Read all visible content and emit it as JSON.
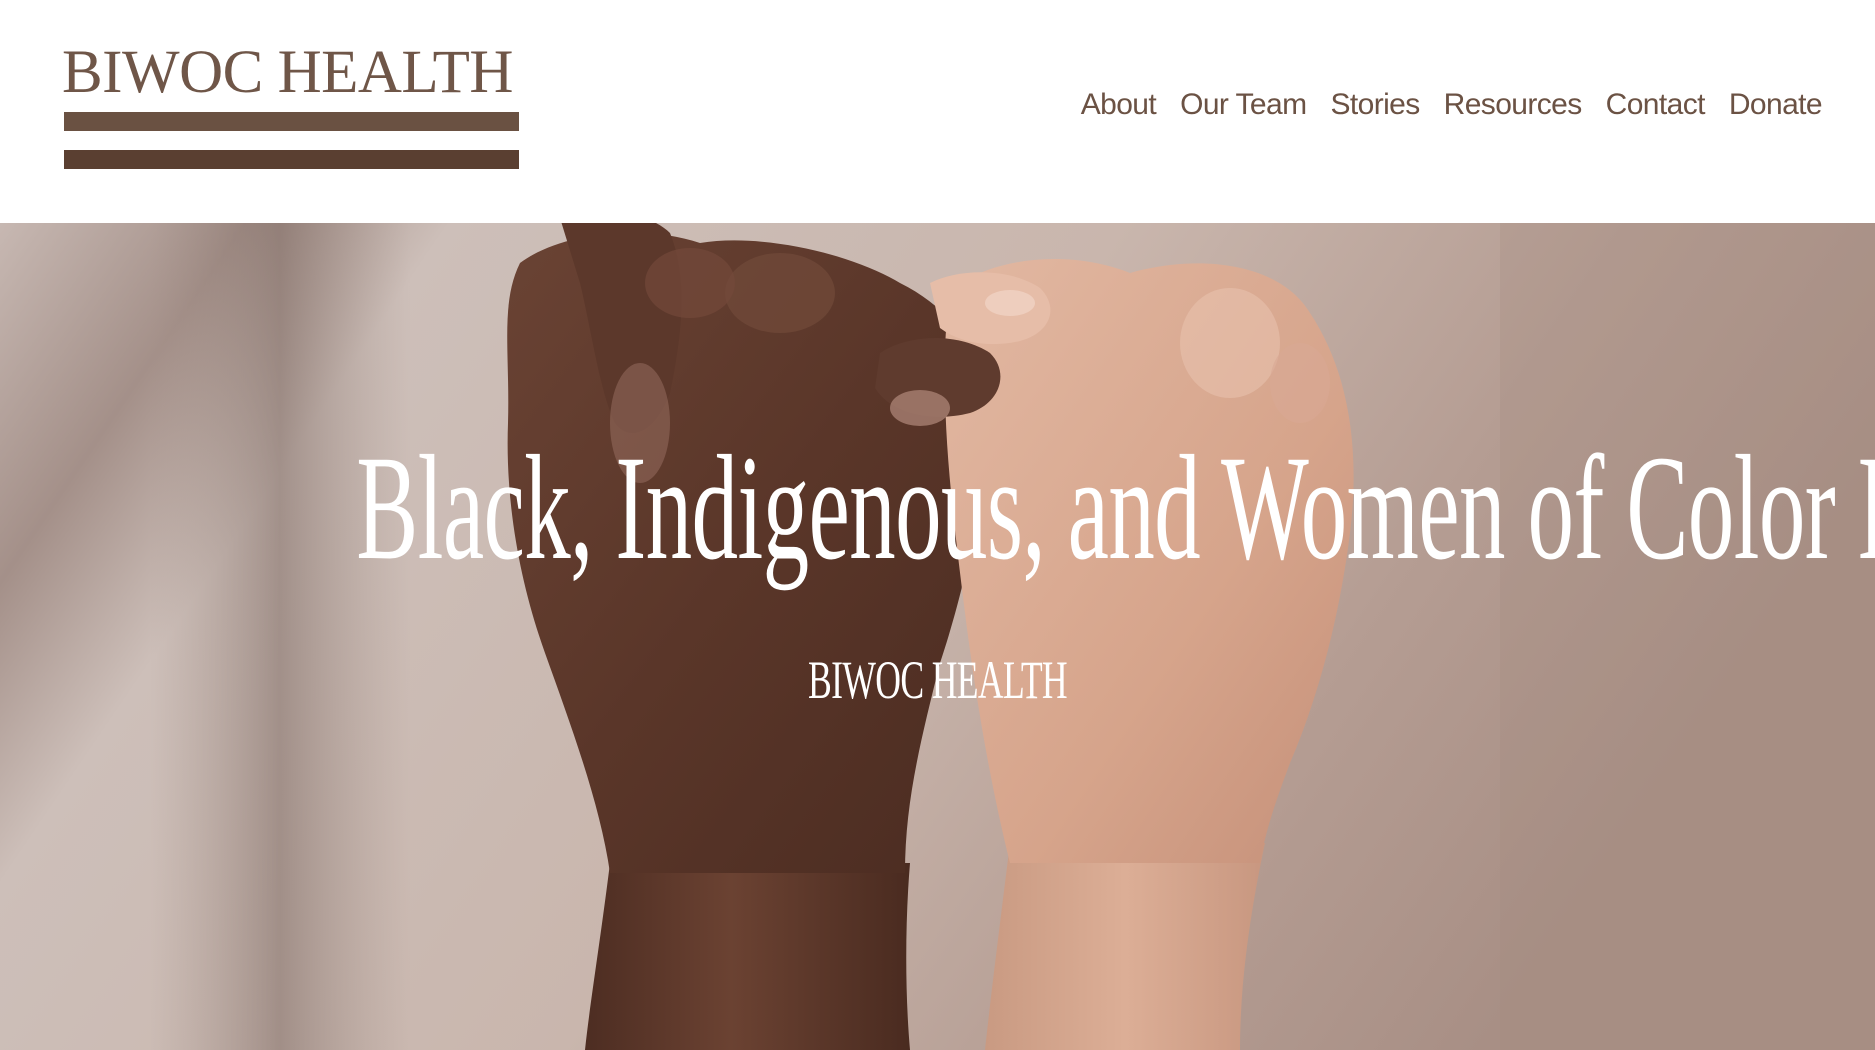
{
  "header": {
    "logo": {
      "text": "BIWOC HEALTH",
      "color": "#6f5648",
      "bar_color": "#5f4638"
    },
    "nav": [
      {
        "label": "About"
      },
      {
        "label": "Our Team"
      },
      {
        "label": "Stories"
      },
      {
        "label": "Resources"
      },
      {
        "label": "Contact"
      },
      {
        "label": "Donate"
      }
    ],
    "nav_color": "#6b5244"
  },
  "hero": {
    "title": "Black, Indigenous, and Women of Color Health",
    "subtitle": "BIWOC HEALTH",
    "text_color": "#ffffff",
    "image_subject": "two-hands-pinky-promise-photo"
  }
}
